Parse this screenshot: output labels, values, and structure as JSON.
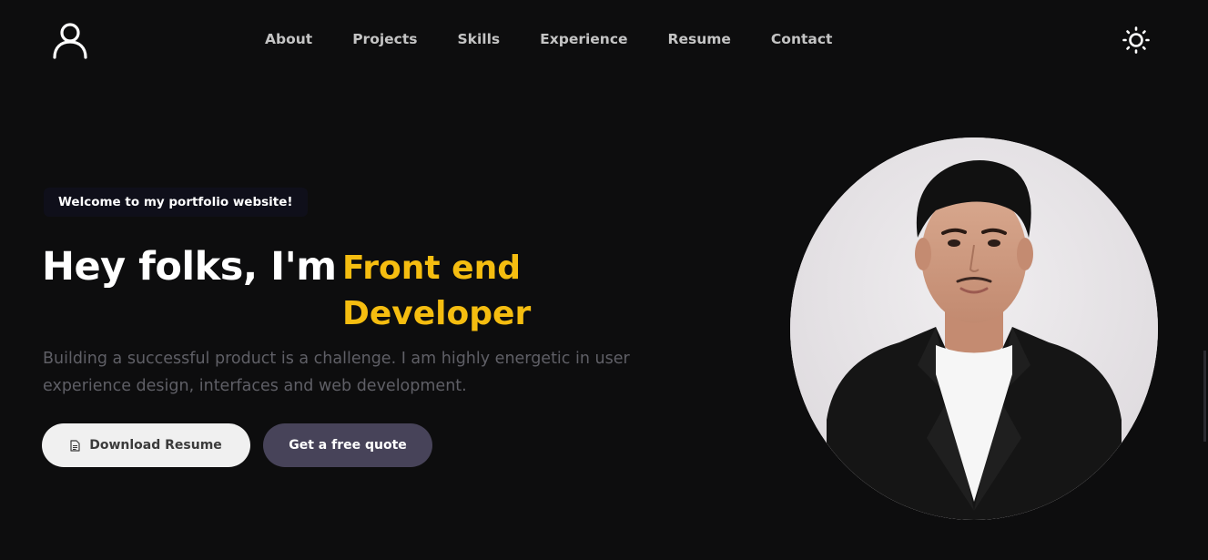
{
  "header": {
    "logo_icon": "user-outline-icon",
    "nav": [
      {
        "label": "About"
      },
      {
        "label": "Projects"
      },
      {
        "label": "Skills"
      },
      {
        "label": "Experience"
      },
      {
        "label": "Resume"
      },
      {
        "label": "Contact"
      }
    ],
    "theme_toggle_icon": "sun-icon"
  },
  "hero": {
    "badge": "Welcome to my portfolio website!",
    "title": "Hey folks, I'm",
    "role_line1": "Front end",
    "role_line2": "Developer",
    "description": "Building a successful product is a challenge. I am highly energetic in user experience design, interfaces and web development.",
    "buttons": {
      "download_label": "Download Resume",
      "download_icon": "document-icon",
      "quote_label": "Get a free quote"
    }
  },
  "colors": {
    "background": "#0d0d0e",
    "accent": "#f5bd10",
    "nav_text": "#c4c4c4",
    "muted_text": "#5f5f66",
    "quote_button": "#474359",
    "download_button": "#f0f0f0"
  }
}
